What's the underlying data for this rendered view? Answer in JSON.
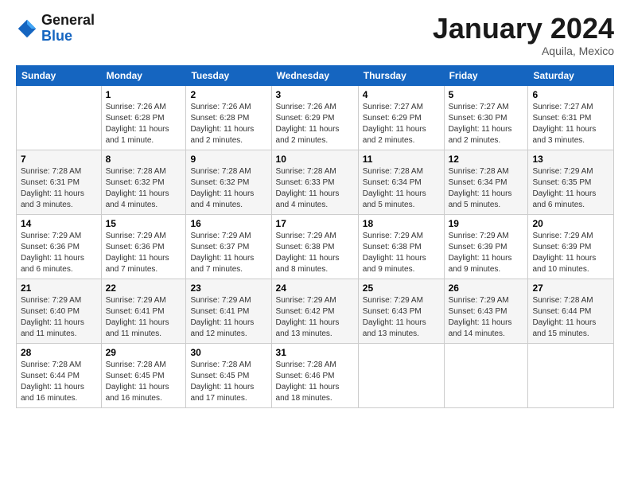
{
  "logo": {
    "line1": "General",
    "line2": "Blue"
  },
  "title": "January 2024",
  "location": "Aquila, Mexico",
  "days_header": [
    "Sunday",
    "Monday",
    "Tuesday",
    "Wednesday",
    "Thursday",
    "Friday",
    "Saturday"
  ],
  "weeks": [
    [
      {
        "day": "",
        "info": ""
      },
      {
        "day": "1",
        "info": "Sunrise: 7:26 AM\nSunset: 6:28 PM\nDaylight: 11 hours\nand 1 minute."
      },
      {
        "day": "2",
        "info": "Sunrise: 7:26 AM\nSunset: 6:28 PM\nDaylight: 11 hours\nand 2 minutes."
      },
      {
        "day": "3",
        "info": "Sunrise: 7:26 AM\nSunset: 6:29 PM\nDaylight: 11 hours\nand 2 minutes."
      },
      {
        "day": "4",
        "info": "Sunrise: 7:27 AM\nSunset: 6:29 PM\nDaylight: 11 hours\nand 2 minutes."
      },
      {
        "day": "5",
        "info": "Sunrise: 7:27 AM\nSunset: 6:30 PM\nDaylight: 11 hours\nand 2 minutes."
      },
      {
        "day": "6",
        "info": "Sunrise: 7:27 AM\nSunset: 6:31 PM\nDaylight: 11 hours\nand 3 minutes."
      }
    ],
    [
      {
        "day": "7",
        "info": "Sunrise: 7:28 AM\nSunset: 6:31 PM\nDaylight: 11 hours\nand 3 minutes."
      },
      {
        "day": "8",
        "info": "Sunrise: 7:28 AM\nSunset: 6:32 PM\nDaylight: 11 hours\nand 4 minutes."
      },
      {
        "day": "9",
        "info": "Sunrise: 7:28 AM\nSunset: 6:32 PM\nDaylight: 11 hours\nand 4 minutes."
      },
      {
        "day": "10",
        "info": "Sunrise: 7:28 AM\nSunset: 6:33 PM\nDaylight: 11 hours\nand 4 minutes."
      },
      {
        "day": "11",
        "info": "Sunrise: 7:28 AM\nSunset: 6:34 PM\nDaylight: 11 hours\nand 5 minutes."
      },
      {
        "day": "12",
        "info": "Sunrise: 7:28 AM\nSunset: 6:34 PM\nDaylight: 11 hours\nand 5 minutes."
      },
      {
        "day": "13",
        "info": "Sunrise: 7:29 AM\nSunset: 6:35 PM\nDaylight: 11 hours\nand 6 minutes."
      }
    ],
    [
      {
        "day": "14",
        "info": "Sunrise: 7:29 AM\nSunset: 6:36 PM\nDaylight: 11 hours\nand 6 minutes."
      },
      {
        "day": "15",
        "info": "Sunrise: 7:29 AM\nSunset: 6:36 PM\nDaylight: 11 hours\nand 7 minutes."
      },
      {
        "day": "16",
        "info": "Sunrise: 7:29 AM\nSunset: 6:37 PM\nDaylight: 11 hours\nand 7 minutes."
      },
      {
        "day": "17",
        "info": "Sunrise: 7:29 AM\nSunset: 6:38 PM\nDaylight: 11 hours\nand 8 minutes."
      },
      {
        "day": "18",
        "info": "Sunrise: 7:29 AM\nSunset: 6:38 PM\nDaylight: 11 hours\nand 9 minutes."
      },
      {
        "day": "19",
        "info": "Sunrise: 7:29 AM\nSunset: 6:39 PM\nDaylight: 11 hours\nand 9 minutes."
      },
      {
        "day": "20",
        "info": "Sunrise: 7:29 AM\nSunset: 6:39 PM\nDaylight: 11 hours\nand 10 minutes."
      }
    ],
    [
      {
        "day": "21",
        "info": "Sunrise: 7:29 AM\nSunset: 6:40 PM\nDaylight: 11 hours\nand 11 minutes."
      },
      {
        "day": "22",
        "info": "Sunrise: 7:29 AM\nSunset: 6:41 PM\nDaylight: 11 hours\nand 11 minutes."
      },
      {
        "day": "23",
        "info": "Sunrise: 7:29 AM\nSunset: 6:41 PM\nDaylight: 11 hours\nand 12 minutes."
      },
      {
        "day": "24",
        "info": "Sunrise: 7:29 AM\nSunset: 6:42 PM\nDaylight: 11 hours\nand 13 minutes."
      },
      {
        "day": "25",
        "info": "Sunrise: 7:29 AM\nSunset: 6:43 PM\nDaylight: 11 hours\nand 13 minutes."
      },
      {
        "day": "26",
        "info": "Sunrise: 7:29 AM\nSunset: 6:43 PM\nDaylight: 11 hours\nand 14 minutes."
      },
      {
        "day": "27",
        "info": "Sunrise: 7:28 AM\nSunset: 6:44 PM\nDaylight: 11 hours\nand 15 minutes."
      }
    ],
    [
      {
        "day": "28",
        "info": "Sunrise: 7:28 AM\nSunset: 6:44 PM\nDaylight: 11 hours\nand 16 minutes."
      },
      {
        "day": "29",
        "info": "Sunrise: 7:28 AM\nSunset: 6:45 PM\nDaylight: 11 hours\nand 16 minutes."
      },
      {
        "day": "30",
        "info": "Sunrise: 7:28 AM\nSunset: 6:45 PM\nDaylight: 11 hours\nand 17 minutes."
      },
      {
        "day": "31",
        "info": "Sunrise: 7:28 AM\nSunset: 6:46 PM\nDaylight: 11 hours\nand 18 minutes."
      },
      {
        "day": "",
        "info": ""
      },
      {
        "day": "",
        "info": ""
      },
      {
        "day": "",
        "info": ""
      }
    ]
  ]
}
